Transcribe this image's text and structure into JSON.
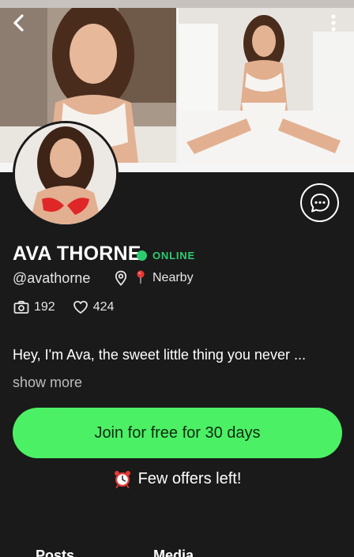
{
  "profile": {
    "name": "AVA THORNE",
    "status": "ONLINE",
    "handle": "@avathorne",
    "location": "Nearby",
    "stats": {
      "photos": "192",
      "likes": "424"
    },
    "bio": "Hey, I'm Ava, the sweet little thing you never ...",
    "show_more": "show more"
  },
  "cta": {
    "join_label": "Join for free for 30 days",
    "offers_text": "Few offers left!"
  },
  "tabs": [
    {
      "label": "Posts"
    },
    {
      "label": "Media"
    }
  ],
  "icons": {
    "back": "chevron-left-icon",
    "more": "more-vertical-icon",
    "chat": "chat-bubble-icon",
    "location": "location-outline-icon",
    "pin": "round-pushpin-emoji",
    "camera": "camera-icon",
    "heart": "heart-icon",
    "alarm": "alarm-clock-emoji"
  },
  "colors": {
    "background": "#1a1a1a",
    "accent_green": "#4cf065",
    "online_green": "#2ecc71"
  }
}
